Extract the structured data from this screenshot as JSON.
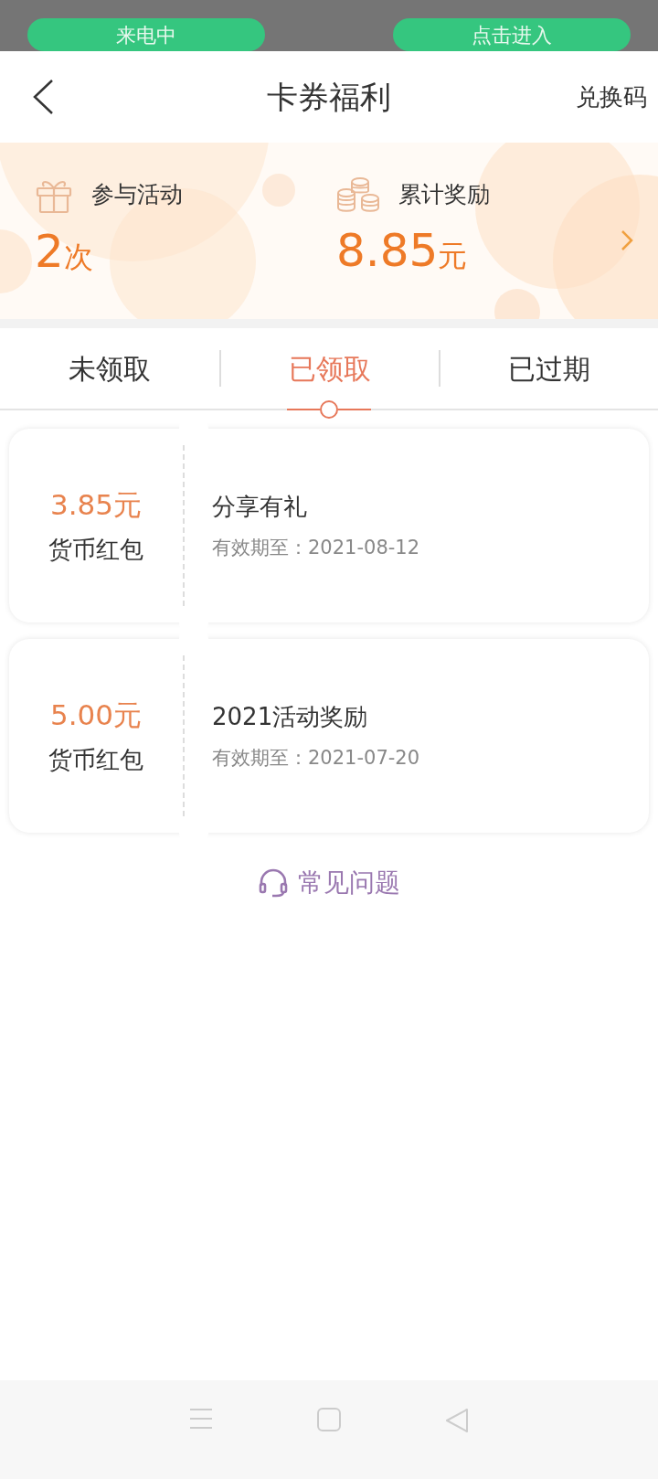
{
  "call_banner": {
    "status": "来电中",
    "action": "点击进入"
  },
  "header": {
    "title": "卡券福利",
    "action": "兑换码"
  },
  "summary": [
    {
      "kind": "gift",
      "label": "参与活动",
      "value": "2",
      "unit": "次"
    },
    {
      "kind": "coins",
      "label": "累计奖励",
      "value": "8.85",
      "unit": "元"
    }
  ],
  "tabs": [
    {
      "label": "未领取",
      "selected": false
    },
    {
      "label": "已领取",
      "selected": true
    },
    {
      "label": "已过期",
      "selected": false
    }
  ],
  "coupons": [
    {
      "amount": "3.85元",
      "type": "货币红包",
      "title": "分享有礼",
      "expiry": "有效期至：2021-08-12"
    },
    {
      "amount": "5.00元",
      "type": "货币红包",
      "title": "2021活动奖励",
      "expiry": "有效期至：2021-07-20"
    }
  ],
  "faq": "常见问题"
}
